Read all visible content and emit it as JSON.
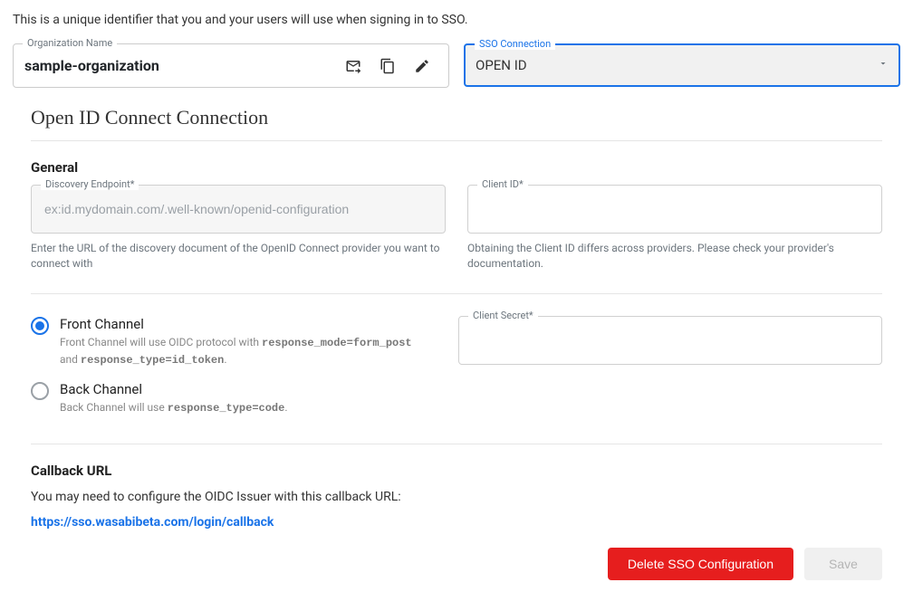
{
  "intro": "This is a unique identifier that you and your users will use when signing in to SSO.",
  "org": {
    "label": "Organization Name",
    "value": "sample-organization"
  },
  "sso": {
    "label": "SSO Connection",
    "value": "OPEN ID"
  },
  "section": {
    "title": "Open ID Connect Connection"
  },
  "general": {
    "title": "General",
    "discovery": {
      "label": "Discovery Endpoint*",
      "placeholder": "ex:id.mydomain.com/.well-known/openid-configuration",
      "helper": "Enter the URL of the discovery document of the OpenID Connect provider you want to connect with"
    },
    "clientId": {
      "label": "Client ID*",
      "helper": "Obtaining the Client ID differs across providers. Please check your provider's documentation."
    }
  },
  "channels": {
    "front": {
      "label": "Front Channel",
      "desc_pre": "Front Channel will use OIDC protocol with ",
      "code1": "response_mode=form_post",
      "desc_mid": " and ",
      "code2": "response_type=id_token",
      "desc_end": "."
    },
    "back": {
      "label": "Back Channel",
      "desc_pre": "Back Channel will use ",
      "code1": "response_type=code",
      "desc_end": "."
    },
    "clientSecret": {
      "label": "Client Secret*"
    }
  },
  "callback": {
    "title": "Callback URL",
    "text": "You may need to configure the OIDC Issuer with this callback URL:",
    "url": "https://sso.wasabibeta.com/login/callback"
  },
  "footer": {
    "delete": "Delete SSO Configuration",
    "save": "Save"
  }
}
